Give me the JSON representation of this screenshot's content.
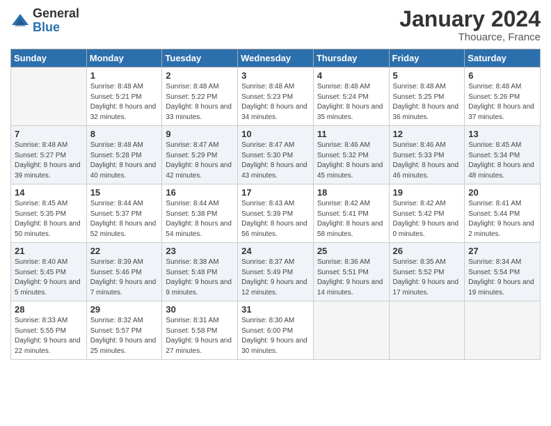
{
  "header": {
    "logo_general": "General",
    "logo_blue": "Blue",
    "title": "January 2024",
    "subtitle": "Thouarce, France"
  },
  "weekdays": [
    "Sunday",
    "Monday",
    "Tuesday",
    "Wednesday",
    "Thursday",
    "Friday",
    "Saturday"
  ],
  "weeks": [
    [
      {
        "day": "",
        "sunrise": "",
        "sunset": "",
        "daylight": "",
        "empty": true
      },
      {
        "day": "1",
        "sunrise": "Sunrise: 8:48 AM",
        "sunset": "Sunset: 5:21 PM",
        "daylight": "Daylight: 8 hours and 32 minutes."
      },
      {
        "day": "2",
        "sunrise": "Sunrise: 8:48 AM",
        "sunset": "Sunset: 5:22 PM",
        "daylight": "Daylight: 8 hours and 33 minutes."
      },
      {
        "day": "3",
        "sunrise": "Sunrise: 8:48 AM",
        "sunset": "Sunset: 5:23 PM",
        "daylight": "Daylight: 8 hours and 34 minutes."
      },
      {
        "day": "4",
        "sunrise": "Sunrise: 8:48 AM",
        "sunset": "Sunset: 5:24 PM",
        "daylight": "Daylight: 8 hours and 35 minutes."
      },
      {
        "day": "5",
        "sunrise": "Sunrise: 8:48 AM",
        "sunset": "Sunset: 5:25 PM",
        "daylight": "Daylight: 8 hours and 36 minutes."
      },
      {
        "day": "6",
        "sunrise": "Sunrise: 8:48 AM",
        "sunset": "Sunset: 5:26 PM",
        "daylight": "Daylight: 8 hours and 37 minutes."
      }
    ],
    [
      {
        "day": "7",
        "sunrise": "Sunrise: 8:48 AM",
        "sunset": "Sunset: 5:27 PM",
        "daylight": "Daylight: 8 hours and 39 minutes."
      },
      {
        "day": "8",
        "sunrise": "Sunrise: 8:48 AM",
        "sunset": "Sunset: 5:28 PM",
        "daylight": "Daylight: 8 hours and 40 minutes."
      },
      {
        "day": "9",
        "sunrise": "Sunrise: 8:47 AM",
        "sunset": "Sunset: 5:29 PM",
        "daylight": "Daylight: 8 hours and 42 minutes."
      },
      {
        "day": "10",
        "sunrise": "Sunrise: 8:47 AM",
        "sunset": "Sunset: 5:30 PM",
        "daylight": "Daylight: 8 hours and 43 minutes."
      },
      {
        "day": "11",
        "sunrise": "Sunrise: 8:46 AM",
        "sunset": "Sunset: 5:32 PM",
        "daylight": "Daylight: 8 hours and 45 minutes."
      },
      {
        "day": "12",
        "sunrise": "Sunrise: 8:46 AM",
        "sunset": "Sunset: 5:33 PM",
        "daylight": "Daylight: 8 hours and 46 minutes."
      },
      {
        "day": "13",
        "sunrise": "Sunrise: 8:45 AM",
        "sunset": "Sunset: 5:34 PM",
        "daylight": "Daylight: 8 hours and 48 minutes."
      }
    ],
    [
      {
        "day": "14",
        "sunrise": "Sunrise: 8:45 AM",
        "sunset": "Sunset: 5:35 PM",
        "daylight": "Daylight: 8 hours and 50 minutes."
      },
      {
        "day": "15",
        "sunrise": "Sunrise: 8:44 AM",
        "sunset": "Sunset: 5:37 PM",
        "daylight": "Daylight: 8 hours and 52 minutes."
      },
      {
        "day": "16",
        "sunrise": "Sunrise: 8:44 AM",
        "sunset": "Sunset: 5:38 PM",
        "daylight": "Daylight: 8 hours and 54 minutes."
      },
      {
        "day": "17",
        "sunrise": "Sunrise: 8:43 AM",
        "sunset": "Sunset: 5:39 PM",
        "daylight": "Daylight: 8 hours and 56 minutes."
      },
      {
        "day": "18",
        "sunrise": "Sunrise: 8:42 AM",
        "sunset": "Sunset: 5:41 PM",
        "daylight": "Daylight: 8 hours and 58 minutes."
      },
      {
        "day": "19",
        "sunrise": "Sunrise: 8:42 AM",
        "sunset": "Sunset: 5:42 PM",
        "daylight": "Daylight: 9 hours and 0 minutes."
      },
      {
        "day": "20",
        "sunrise": "Sunrise: 8:41 AM",
        "sunset": "Sunset: 5:44 PM",
        "daylight": "Daylight: 9 hours and 2 minutes."
      }
    ],
    [
      {
        "day": "21",
        "sunrise": "Sunrise: 8:40 AM",
        "sunset": "Sunset: 5:45 PM",
        "daylight": "Daylight: 9 hours and 5 minutes."
      },
      {
        "day": "22",
        "sunrise": "Sunrise: 8:39 AM",
        "sunset": "Sunset: 5:46 PM",
        "daylight": "Daylight: 9 hours and 7 minutes."
      },
      {
        "day": "23",
        "sunrise": "Sunrise: 8:38 AM",
        "sunset": "Sunset: 5:48 PM",
        "daylight": "Daylight: 9 hours and 9 minutes."
      },
      {
        "day": "24",
        "sunrise": "Sunrise: 8:37 AM",
        "sunset": "Sunset: 5:49 PM",
        "daylight": "Daylight: 9 hours and 12 minutes."
      },
      {
        "day": "25",
        "sunrise": "Sunrise: 8:36 AM",
        "sunset": "Sunset: 5:51 PM",
        "daylight": "Daylight: 9 hours and 14 minutes."
      },
      {
        "day": "26",
        "sunrise": "Sunrise: 8:35 AM",
        "sunset": "Sunset: 5:52 PM",
        "daylight": "Daylight: 9 hours and 17 minutes."
      },
      {
        "day": "27",
        "sunrise": "Sunrise: 8:34 AM",
        "sunset": "Sunset: 5:54 PM",
        "daylight": "Daylight: 9 hours and 19 minutes."
      }
    ],
    [
      {
        "day": "28",
        "sunrise": "Sunrise: 8:33 AM",
        "sunset": "Sunset: 5:55 PM",
        "daylight": "Daylight: 9 hours and 22 minutes."
      },
      {
        "day": "29",
        "sunrise": "Sunrise: 8:32 AM",
        "sunset": "Sunset: 5:57 PM",
        "daylight": "Daylight: 9 hours and 25 minutes."
      },
      {
        "day": "30",
        "sunrise": "Sunrise: 8:31 AM",
        "sunset": "Sunset: 5:58 PM",
        "daylight": "Daylight: 9 hours and 27 minutes."
      },
      {
        "day": "31",
        "sunrise": "Sunrise: 8:30 AM",
        "sunset": "Sunset: 6:00 PM",
        "daylight": "Daylight: 9 hours and 30 minutes."
      },
      {
        "day": "",
        "sunrise": "",
        "sunset": "",
        "daylight": "",
        "empty": true
      },
      {
        "day": "",
        "sunrise": "",
        "sunset": "",
        "daylight": "",
        "empty": true
      },
      {
        "day": "",
        "sunrise": "",
        "sunset": "",
        "daylight": "",
        "empty": true
      }
    ]
  ]
}
